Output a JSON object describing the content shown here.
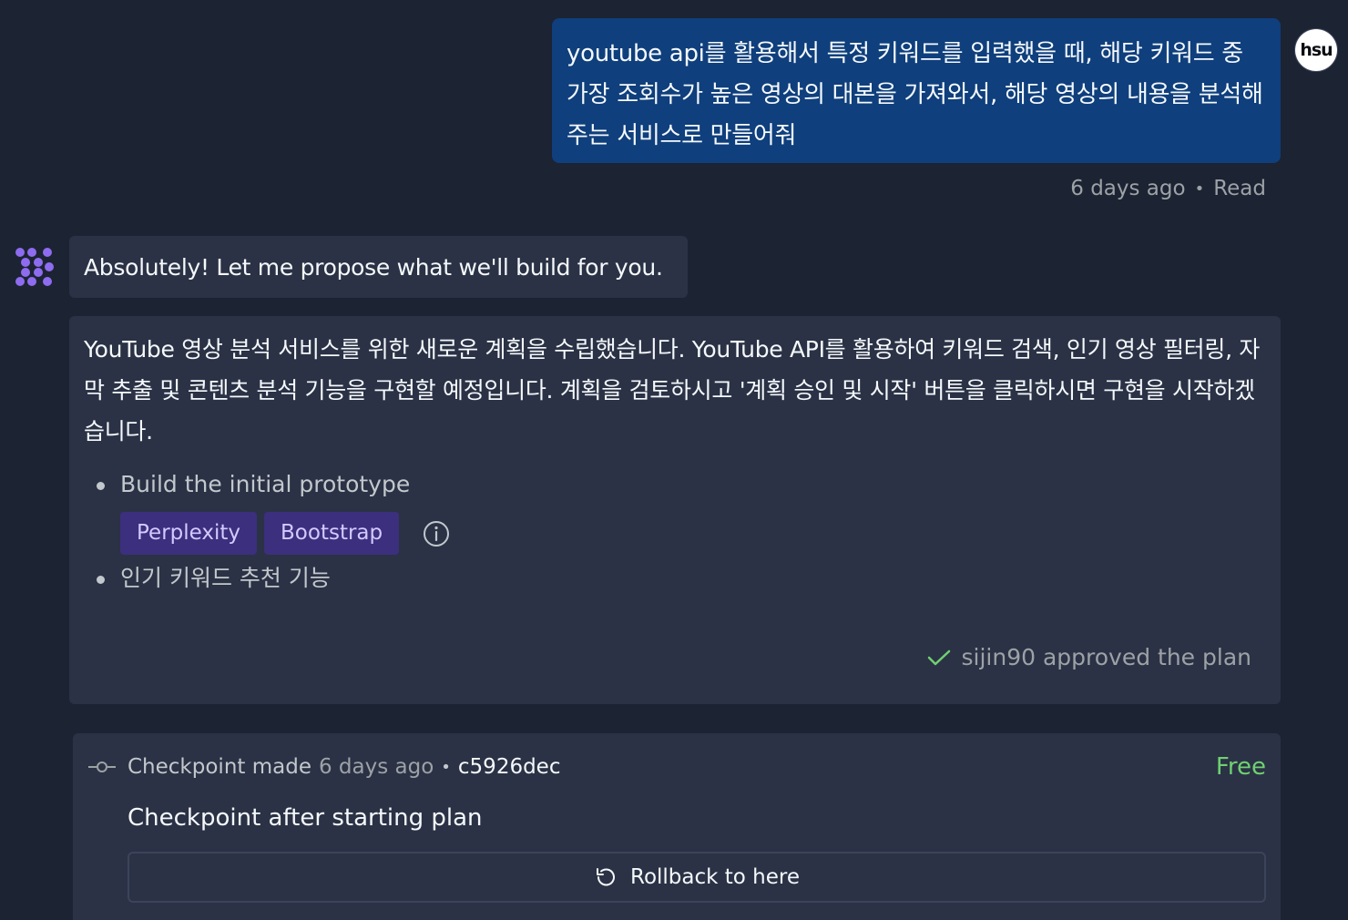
{
  "user_message": {
    "text": "youtube api를 활용해서 특정 키워드를 입력했을 때, 해당 키워드 중 가장 조회수가 높은 영상의 대본을 가져와서, 해당 영상의 내용을 분석해주는 서비스로 만들어줘",
    "timestamp": "6 days ago",
    "status": "Read",
    "avatar_text": "hsu"
  },
  "agent": {
    "intro": "Absolutely! Let me propose what we'll build for you.",
    "icon": "agent-logo-icon",
    "accent_color": "#8e6cf0"
  },
  "plan": {
    "description": "YouTube 영상 분석 서비스를 위한 새로운 계획을 수립했습니다. YouTube API를 활용하여 키워드 검색, 인기 영상 필터링, 자막 추출 및 콘텐츠 분석 기능을 구현할 예정입니다. 계획을 검토하시고 '계획 승인 및 시작' 버튼을 클릭하시면 구현을 시작하겠습니다.",
    "items": [
      {
        "label": "Build the initial prototype",
        "tags": [
          "Perplexity",
          "Bootstrap"
        ]
      },
      {
        "label": "인기 키워드 추천 기능"
      }
    ],
    "approval": "sijin90 approved the plan",
    "approval_color": "#6fd071"
  },
  "checkpoint": {
    "label": "Checkpoint made",
    "time": "6 days ago",
    "hash": "c5926dec",
    "badge": "Free",
    "title": "Checkpoint after starting plan",
    "rollback_label": "Rollback to here"
  }
}
